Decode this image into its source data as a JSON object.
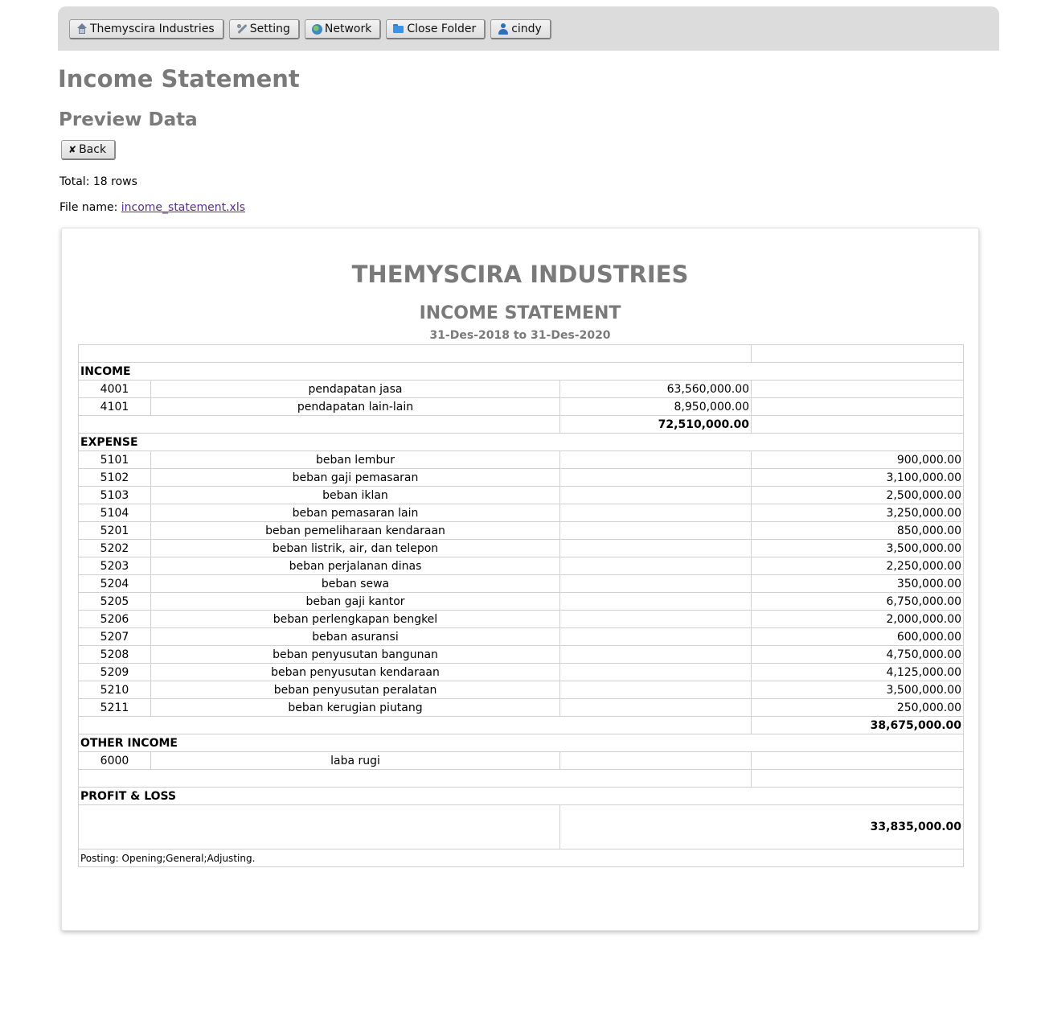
{
  "topbar": {
    "items": [
      {
        "label": "Themyscira Industries",
        "icon": "home-icon"
      },
      {
        "label": "Setting",
        "icon": "wrench-icon"
      },
      {
        "label": "Network",
        "icon": "globe-icon"
      },
      {
        "label": "Close Folder",
        "icon": "folder-icon"
      },
      {
        "label": "cindy",
        "icon": "user-icon"
      }
    ]
  },
  "page": {
    "title": "Income Statement",
    "subtitle": "Preview Data",
    "back_label": "Back",
    "total": "Total: 18 rows",
    "file_label": "File name:",
    "file_name": "income_statement.xls"
  },
  "report": {
    "company": "THEMYSCIRA INDUSTRIES",
    "title": "INCOME STATEMENT",
    "period": "31-Des-2018 to 31-Des-2020",
    "income": {
      "label": "INCOME",
      "rows": [
        {
          "code": "4001",
          "name": "pendapatan jasa",
          "amount": "63,560,000.00"
        },
        {
          "code": "4101",
          "name": "pendapatan lain-lain",
          "amount": "8,950,000.00"
        }
      ],
      "total": "72,510,000.00"
    },
    "expense": {
      "label": "EXPENSE",
      "rows": [
        {
          "code": "5101",
          "name": "beban lembur",
          "amount": "900,000.00"
        },
        {
          "code": "5102",
          "name": "beban gaji pemasaran",
          "amount": "3,100,000.00"
        },
        {
          "code": "5103",
          "name": "beban iklan",
          "amount": "2,500,000.00"
        },
        {
          "code": "5104",
          "name": "beban pemasaran lain",
          "amount": "3,250,000.00"
        },
        {
          "code": "5201",
          "name": "beban pemeliharaan kendaraan",
          "amount": "850,000.00"
        },
        {
          "code": "5202",
          "name": "beban listrik, air, dan telepon",
          "amount": "3,500,000.00"
        },
        {
          "code": "5203",
          "name": "beban perjalanan dinas",
          "amount": "2,250,000.00"
        },
        {
          "code": "5204",
          "name": "beban sewa",
          "amount": "350,000.00"
        },
        {
          "code": "5205",
          "name": "beban gaji kantor",
          "amount": "6,750,000.00"
        },
        {
          "code": "5206",
          "name": "beban perlengkapan bengkel",
          "amount": "2,000,000.00"
        },
        {
          "code": "5207",
          "name": "beban asuransi",
          "amount": "600,000.00"
        },
        {
          "code": "5208",
          "name": "beban penyusutan bangunan",
          "amount": "4,750,000.00"
        },
        {
          "code": "5209",
          "name": "beban penyusutan kendaraan",
          "amount": "4,125,000.00"
        },
        {
          "code": "5210",
          "name": "beban penyusutan peralatan",
          "amount": "3,500,000.00"
        },
        {
          "code": "5211",
          "name": "beban kerugian piutang",
          "amount": "250,000.00"
        }
      ],
      "total": "38,675,000.00"
    },
    "other_income": {
      "label": "OTHER INCOME",
      "rows": [
        {
          "code": "6000",
          "name": "laba rugi",
          "amount": ""
        }
      ]
    },
    "profit_loss": {
      "label": "PROFIT & LOSS",
      "value": "33,835,000.00"
    },
    "posting": "Posting: Opening;General;Adjusting."
  }
}
